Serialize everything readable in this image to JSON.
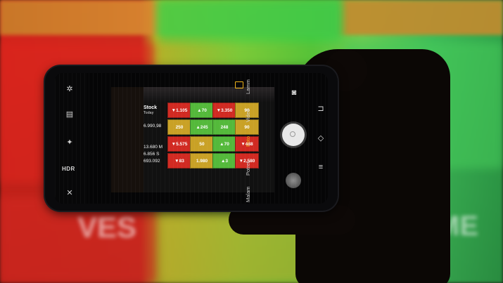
{
  "camera_modes": [
    "Lamm",
    "Video",
    "Foto",
    "Potret",
    "Malam"
  ],
  "active_mode": "Foto",
  "left_controls": {
    "hdr_label": "HDR"
  },
  "stock_screen": {
    "header": "Stock",
    "header2": "Today",
    "ticker_values": [
      "6.990,98",
      "13.680 M",
      "6.856 S",
      "693.092"
    ],
    "cells": [
      {
        "text": "▼1.105",
        "color": "#d12a22"
      },
      {
        "text": "▲70",
        "color": "#54b93b"
      },
      {
        "text": "▼3.350",
        "color": "#d12a22"
      },
      {
        "text": "90",
        "color": "#c9a126"
      },
      {
        "text": "250",
        "color": "#c9a126"
      },
      {
        "text": "▲245",
        "color": "#54b93b"
      },
      {
        "text": "248",
        "color": "#54b93b"
      },
      {
        "text": "90",
        "color": "#c9a126"
      },
      {
        "text": "▼5.575",
        "color": "#d12a22"
      },
      {
        "text": "50",
        "color": "#c9a126"
      },
      {
        "text": "▲70",
        "color": "#54b93b"
      },
      {
        "text": "▼488",
        "color": "#d12a22"
      },
      {
        "text": "▼83",
        "color": "#d12a22"
      },
      {
        "text": "1.980",
        "color": "#c9a126"
      },
      {
        "text": "▲3",
        "color": "#54b93b"
      },
      {
        "text": "▼2.580",
        "color": "#d12a22"
      }
    ]
  },
  "background": {
    "glow_texts": [
      "VES",
      "ME"
    ]
  },
  "colors": {
    "accent": "#f0b419",
    "down": "#d12a22",
    "up": "#54b93b",
    "flat": "#c9a126"
  },
  "icons": [
    "settings-icon",
    "aspect-ratio-icon",
    "filter-icon",
    "timer-icon",
    "flash-icon",
    "switch-camera-icon",
    "menu-icon",
    "shutter-icon",
    "gallery-thumbnail-icon"
  ]
}
